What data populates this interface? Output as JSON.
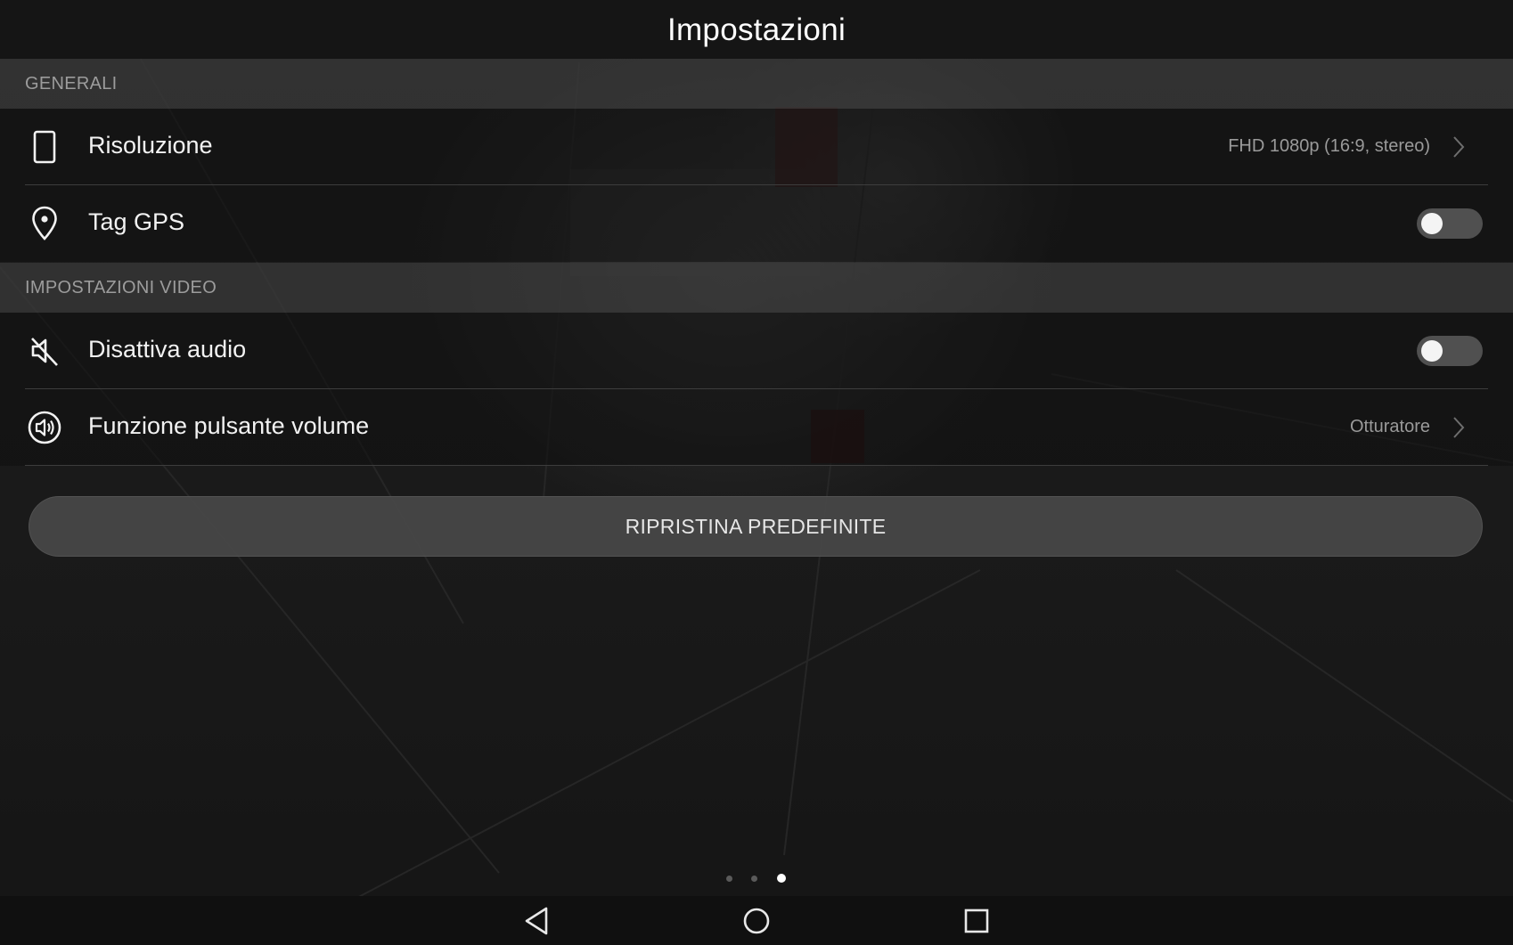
{
  "header": {
    "title": "Impostazioni"
  },
  "sections": [
    {
      "title": "GENERALI",
      "items": [
        {
          "icon": "phone-icon",
          "label": "Risoluzione",
          "value": "FHD 1080p (16:9, stereo)",
          "control": "chevron"
        },
        {
          "icon": "location-pin-icon",
          "label": "Tag GPS",
          "control": "toggle",
          "enabled": false
        }
      ]
    },
    {
      "title": "IMPOSTAZIONI VIDEO",
      "items": [
        {
          "icon": "mute-icon",
          "label": "Disattiva audio",
          "control": "toggle",
          "enabled": false
        },
        {
          "icon": "volume-icon",
          "label": "Funzione pulsante volume",
          "value": "Otturatore",
          "control": "chevron"
        }
      ]
    }
  ],
  "reset_button": {
    "label": "RIPRISTINA PREDEFINITE"
  },
  "page_indicator": {
    "count": 3,
    "active": 3
  },
  "navigation": {
    "buttons": [
      "back-icon",
      "home-icon",
      "recents-icon"
    ]
  },
  "colors": {
    "background": "#141414",
    "section_header_bg": "#3a3a3a",
    "section_header_text": "#9c9c9c",
    "toggle_off_track": "#505050",
    "toggle_knob": "#f4f4f4",
    "button_bg": "#484848"
  }
}
